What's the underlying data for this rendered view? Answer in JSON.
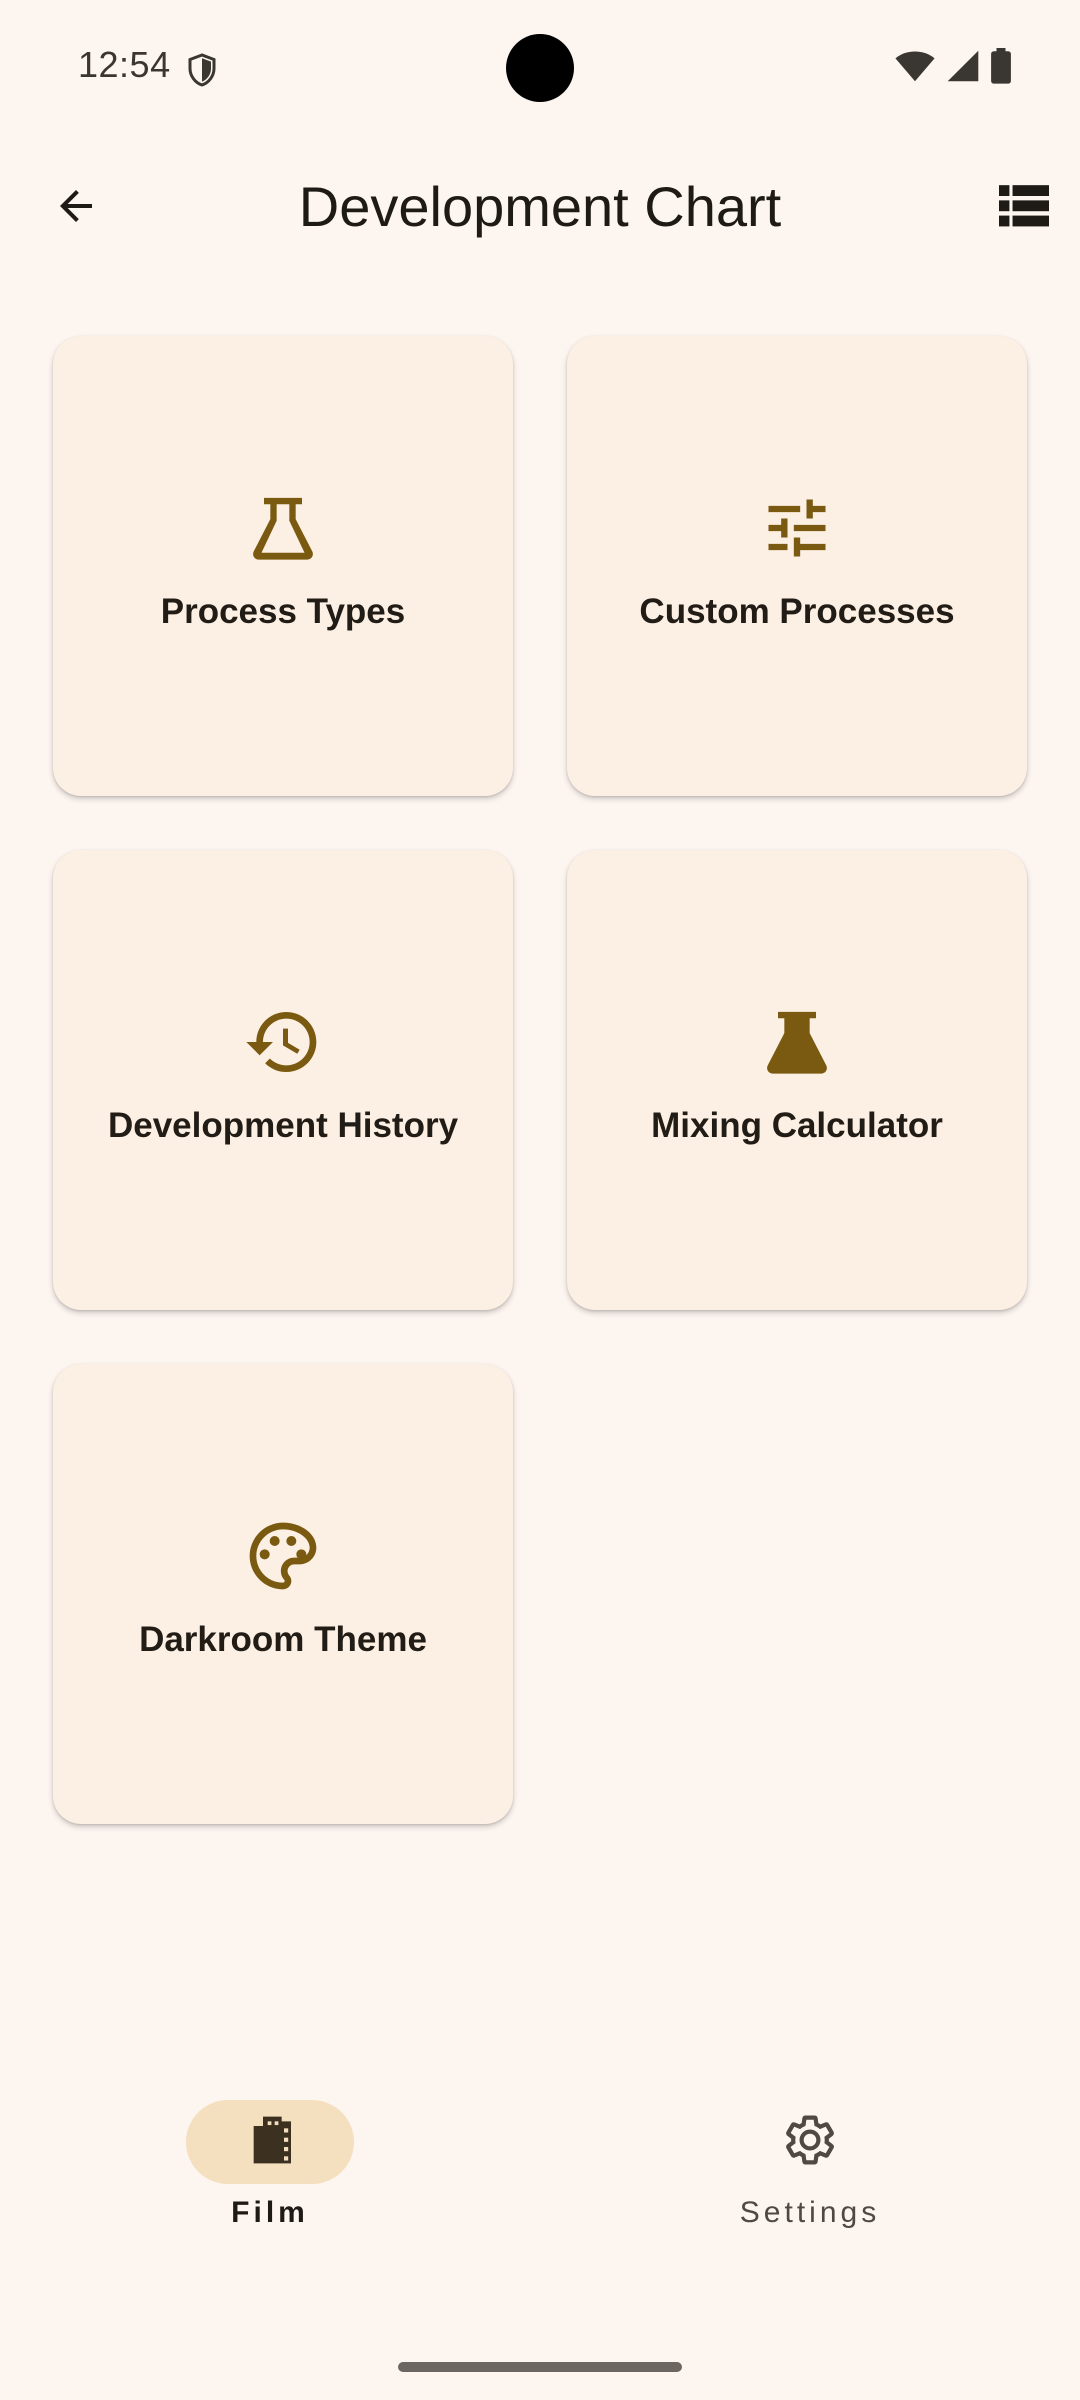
{
  "status_bar": {
    "time": "12:54",
    "icons": [
      "shield-icon",
      "wifi-icon",
      "cellular-signal-icon",
      "battery-icon"
    ]
  },
  "app_bar": {
    "title": "Development Chart",
    "back_icon": "arrow-back-icon",
    "action_icon": "view-list-icon"
  },
  "menu_cards": [
    {
      "label": "Process Types",
      "icon": "flask-outline-icon"
    },
    {
      "label": "Custom Processes",
      "icon": "tune-sliders-icon"
    },
    {
      "label": "Development History",
      "icon": "history-icon"
    },
    {
      "label": "Mixing Calculator",
      "icon": "flask-filled-icon"
    },
    {
      "label": "Darkroom Theme",
      "icon": "palette-icon"
    }
  ],
  "bottom_nav": {
    "items": [
      {
        "label": "Film",
        "icon": "film-icon",
        "selected": true
      },
      {
        "label": "Settings",
        "icon": "gear-icon",
        "selected": false
      }
    ]
  },
  "colors": {
    "background": "#fdf5f0",
    "card_background": "#fcefe3",
    "icon_accent": "#7a5a10",
    "selected_pill": "#f4dfbf",
    "text_primary": "#1e1a16"
  }
}
